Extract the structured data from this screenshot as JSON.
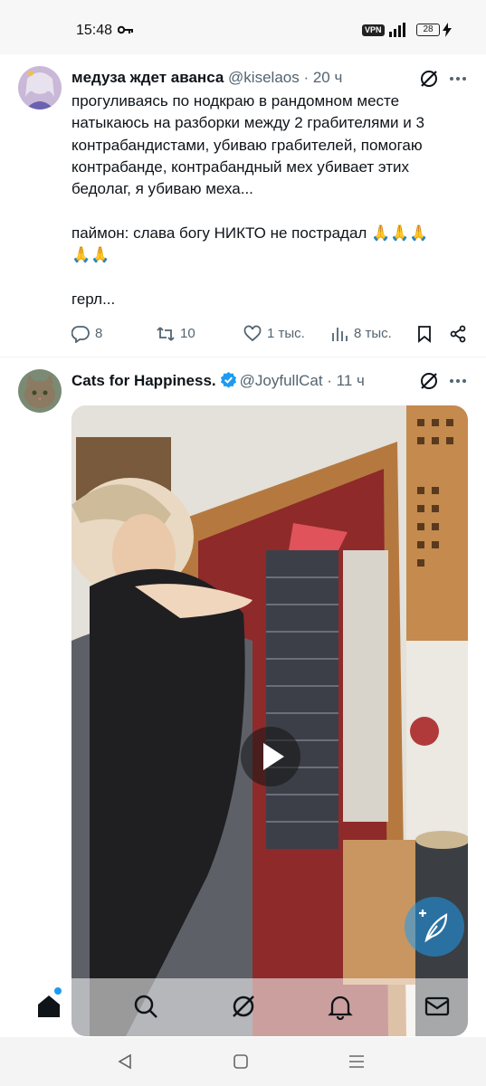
{
  "status_bar": {
    "time": "15:48",
    "vpn": "VPN",
    "battery": "28",
    "icons": [
      "key-icon",
      "signal-icon",
      "battery-icon",
      "charging-bolt-icon"
    ]
  },
  "tweets": [
    {
      "display_name": "медуза ждет аванса",
      "handle": "@kiselaos",
      "time": "· 20 ч",
      "text": "прогуливаясь по нодкраю в рандомном месте натыкаюсь на разборки между 2 грабителями и 3 контрабандистами, убиваю грабителей, помогаю контрабанде, контрабандный мех убивает этих бедолаг, я убиваю меха...\n\nпаймон: слава богу НИКТО не пострадал 🙏🙏🙏\n🙏🙏\n\nгерл...",
      "replies": "8",
      "reposts": "10",
      "likes": "1 тыс.",
      "views": "8 тыс."
    },
    {
      "display_name": "Cats for Happiness.",
      "handle": "@JoyfullCat",
      "time": "· 11 ч",
      "verified": true,
      "media": "video"
    }
  ],
  "bottom_nav": [
    "home-icon",
    "search-icon",
    "grok-icon",
    "notifications-icon",
    "messages-icon"
  ],
  "colors": {
    "accent": "#1d9bf0",
    "text": "#0f1419",
    "secondary": "#536471",
    "verified": "#1d9bf0"
  }
}
